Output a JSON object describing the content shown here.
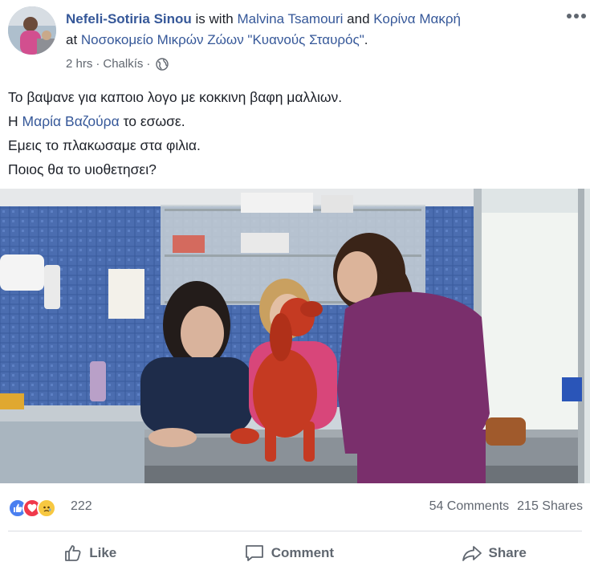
{
  "post": {
    "author": "Nefeli-Sotiria Sinou",
    "with_label": " is with ",
    "tagged_1": "Malvina Tsamouri",
    "and_label": " and ",
    "tagged_2": "Κορίνα Μακρή",
    "at_label": " at ",
    "place": "Νοσοκομείο Μικρών Ζώων \"Κυανούς Σταυρός\"",
    "place_end": ".",
    "time": "2 hrs",
    "dot": "·",
    "location": "Chalkís",
    "privacy_icon": "globe-icon",
    "more_icon": "more-options-icon"
  },
  "body": {
    "line1": "Το βαψανε για καποιο λογο με κοκκινη βαφη μαλλιων.",
    "line2_prefix": "Η ",
    "line2_mention": "Μαρία Βαζούρα",
    "line2_suffix": " το εσωσε.",
    "line3": "Εμεις το πλακωσαμε στα φιλια.",
    "line4": "Ποιος θα το υιοθετησει?"
  },
  "reactions": {
    "icons": [
      "like-icon",
      "love-icon",
      "sad-icon"
    ],
    "count": "222",
    "comments": "54 Comments",
    "shares": "215 Shares"
  },
  "actions": {
    "like": "Like",
    "comment": "Comment",
    "share": "Share"
  },
  "colors": {
    "link": "#365899",
    "meta": "#616770",
    "like_blue": "#4a7ff0",
    "love_red": "#f0394b",
    "sad_yellow": "#f7c841"
  }
}
